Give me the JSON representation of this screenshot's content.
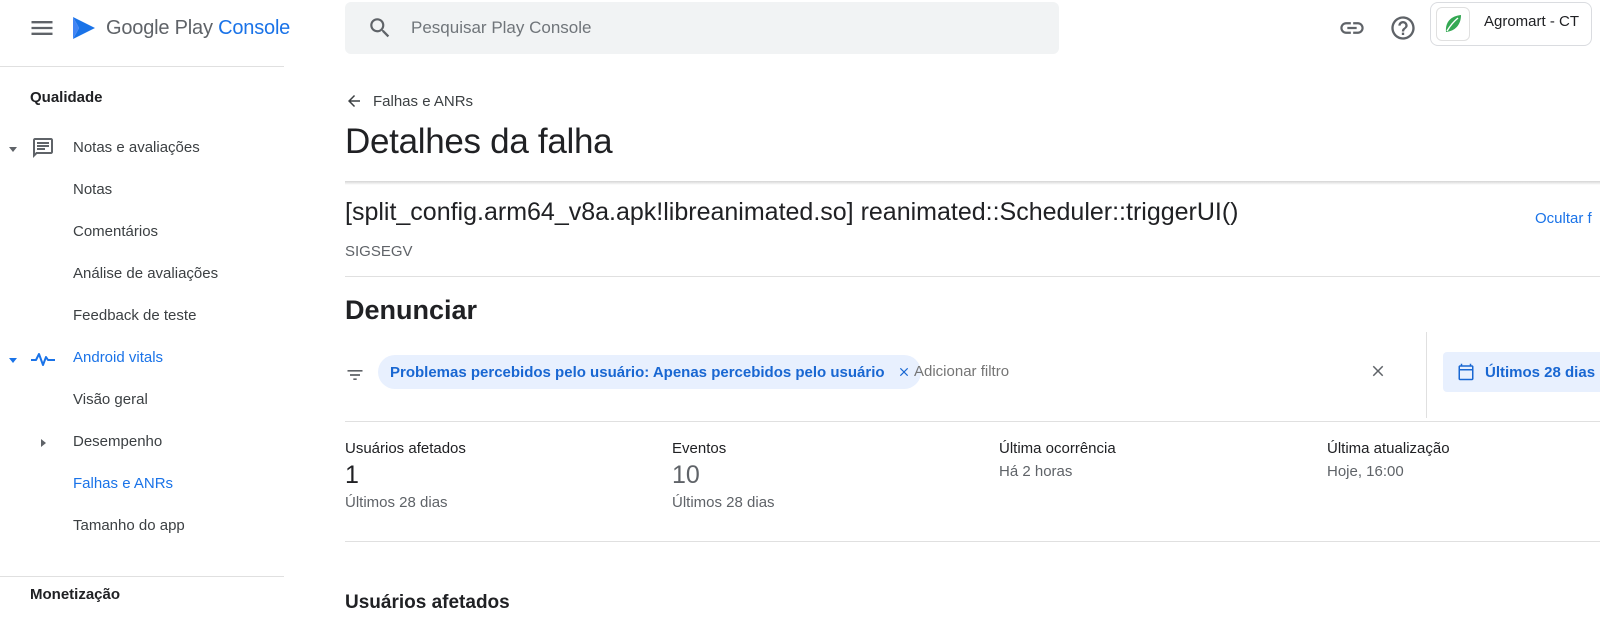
{
  "header": {
    "logo_main": "Google Play",
    "logo_console": "Console",
    "search_placeholder": "Pesquisar Play Console",
    "account_name": "Agromart - CT"
  },
  "sidebar": {
    "section_quality": "Qualidade",
    "items": [
      {
        "label": "Notas e avaliações"
      },
      {
        "label": "Notas"
      },
      {
        "label": "Comentários"
      },
      {
        "label": "Análise de avaliações"
      },
      {
        "label": "Feedback de teste"
      },
      {
        "label": "Android vitals"
      },
      {
        "label": "Visão geral"
      },
      {
        "label": "Desempenho"
      },
      {
        "label": "Falhas e ANRs"
      },
      {
        "label": "Tamanho do app"
      }
    ],
    "section_monetization": "Monetização"
  },
  "main": {
    "back_label": "Falhas e ANRs",
    "page_title": "Detalhes da falha",
    "crash_title": "[split_config.arm64_v8a.apk!libreanimated.so] reanimated::Scheduler::triggerUI()",
    "crash_signal": "SIGSEGV",
    "hide_link": "Ocultar f",
    "report_title": "Denunciar",
    "filter_chip": "Problemas percebidos pelo usuário: Apenas percebidos pelo usuário",
    "add_filter_placeholder": "Adicionar filtro",
    "date_range": "Últimos 28 dias",
    "stats": [
      {
        "label": "Usuários afetados",
        "value": "1",
        "sub": "Últimos 28 dias"
      },
      {
        "label": "Eventos",
        "value": "10",
        "sub": "Últimos 28 dias"
      },
      {
        "label": "Última ocorrência",
        "sub": "Há 2 horas"
      },
      {
        "label": "Última atualização",
        "sub": "Hoje, 16:00"
      }
    ],
    "bottom_section_title": "Usuários afetados"
  },
  "colors": {
    "accent": "#1a73e8",
    "chip_bg": "#e8f0fe",
    "chip_text": "#1967d2"
  }
}
